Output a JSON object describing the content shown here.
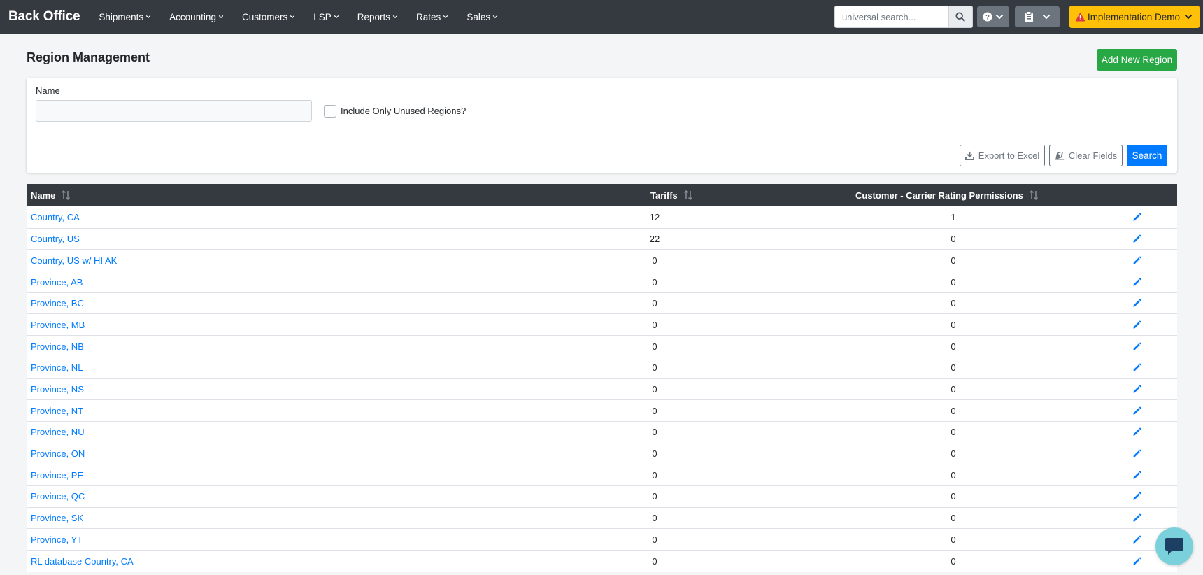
{
  "nav": {
    "brand": "Back Office",
    "menu": [
      "Shipments",
      "Accounting",
      "Customers",
      "LSP",
      "Reports",
      "Rates",
      "Sales"
    ],
    "search_placeholder": "universal search...",
    "environment_label": "Implementation Demo"
  },
  "page": {
    "title": "Region Management",
    "add_button": "Add New Region"
  },
  "filters": {
    "name_label": "Name",
    "name_value": "",
    "unused_checkbox_label": "Include Only Unused Regions?",
    "unused_checked": false,
    "export_button": "Export to Excel",
    "clear_button": "Clear Fields",
    "search_button": "Search"
  },
  "table": {
    "columns": [
      "Name",
      "Tariffs",
      "Customer - Carrier Rating Permissions"
    ],
    "rows": [
      {
        "name": "Country, CA",
        "tariffs": "12",
        "permissions": "1"
      },
      {
        "name": "Country, US",
        "tariffs": "22",
        "permissions": "0"
      },
      {
        "name": "Country, US w/ HI AK",
        "tariffs": "0",
        "permissions": "0"
      },
      {
        "name": "Province, AB",
        "tariffs": "0",
        "permissions": "0"
      },
      {
        "name": "Province, BC",
        "tariffs": "0",
        "permissions": "0"
      },
      {
        "name": "Province, MB",
        "tariffs": "0",
        "permissions": "0"
      },
      {
        "name": "Province, NB",
        "tariffs": "0",
        "permissions": "0"
      },
      {
        "name": "Province, NL",
        "tariffs": "0",
        "permissions": "0"
      },
      {
        "name": "Province, NS",
        "tariffs": "0",
        "permissions": "0"
      },
      {
        "name": "Province, NT",
        "tariffs": "0",
        "permissions": "0"
      },
      {
        "name": "Province, NU",
        "tariffs": "0",
        "permissions": "0"
      },
      {
        "name": "Province, ON",
        "tariffs": "0",
        "permissions": "0"
      },
      {
        "name": "Province, PE",
        "tariffs": "0",
        "permissions": "0"
      },
      {
        "name": "Province, QC",
        "tariffs": "0",
        "permissions": "0"
      },
      {
        "name": "Province, SK",
        "tariffs": "0",
        "permissions": "0"
      },
      {
        "name": "Province, YT",
        "tariffs": "0",
        "permissions": "0"
      },
      {
        "name": "RL database Country, CA",
        "tariffs": "0",
        "permissions": "0"
      }
    ]
  },
  "colors": {
    "navbar": "#343a40",
    "link": "#007bff",
    "success": "#28a745",
    "warning": "#ffc107",
    "chat": "#7ad1dc"
  }
}
